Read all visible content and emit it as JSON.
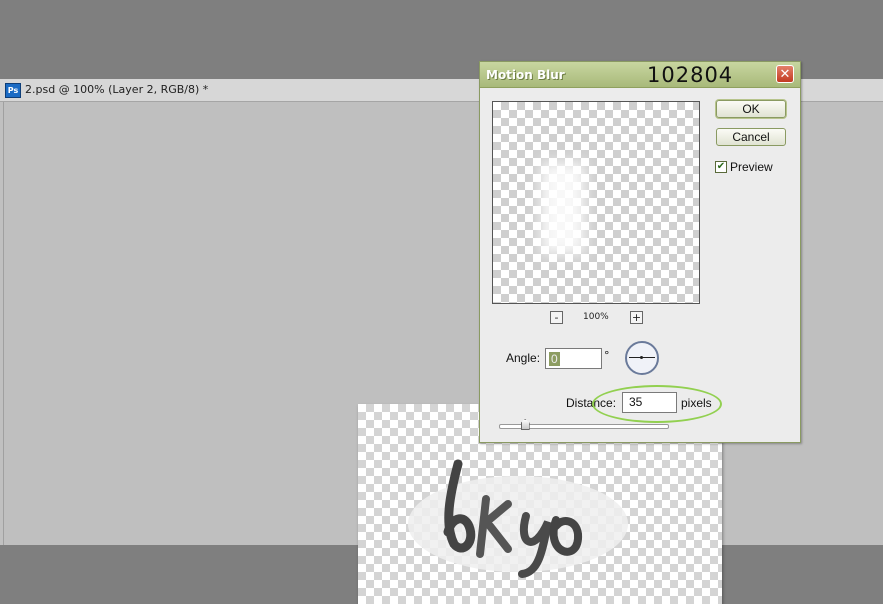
{
  "document": {
    "title": "2.psd @ 100% (Layer 2, RGB/8) *",
    "app_icon_label": "Ps"
  },
  "dialog": {
    "title": "Motion Blur",
    "annotation": "102804",
    "close_glyph": "✕",
    "ok_label": "OK",
    "cancel_label": "Cancel",
    "preview_label": "Preview",
    "preview_checked": true,
    "check_glyph": "✔",
    "zoom_out_label": "-",
    "zoom_in_label": "+",
    "zoom_level": "100%",
    "angle": {
      "label": "Angle:",
      "value": "0",
      "unit": "°"
    },
    "distance": {
      "label": "Distance:",
      "value": "35",
      "unit": "pixels"
    },
    "distance_slider_fraction": 0.12
  },
  "colors": {
    "titlebar_green": "#a8b97a",
    "highlight_green": "#92d050",
    "close_red": "#c23a22"
  }
}
